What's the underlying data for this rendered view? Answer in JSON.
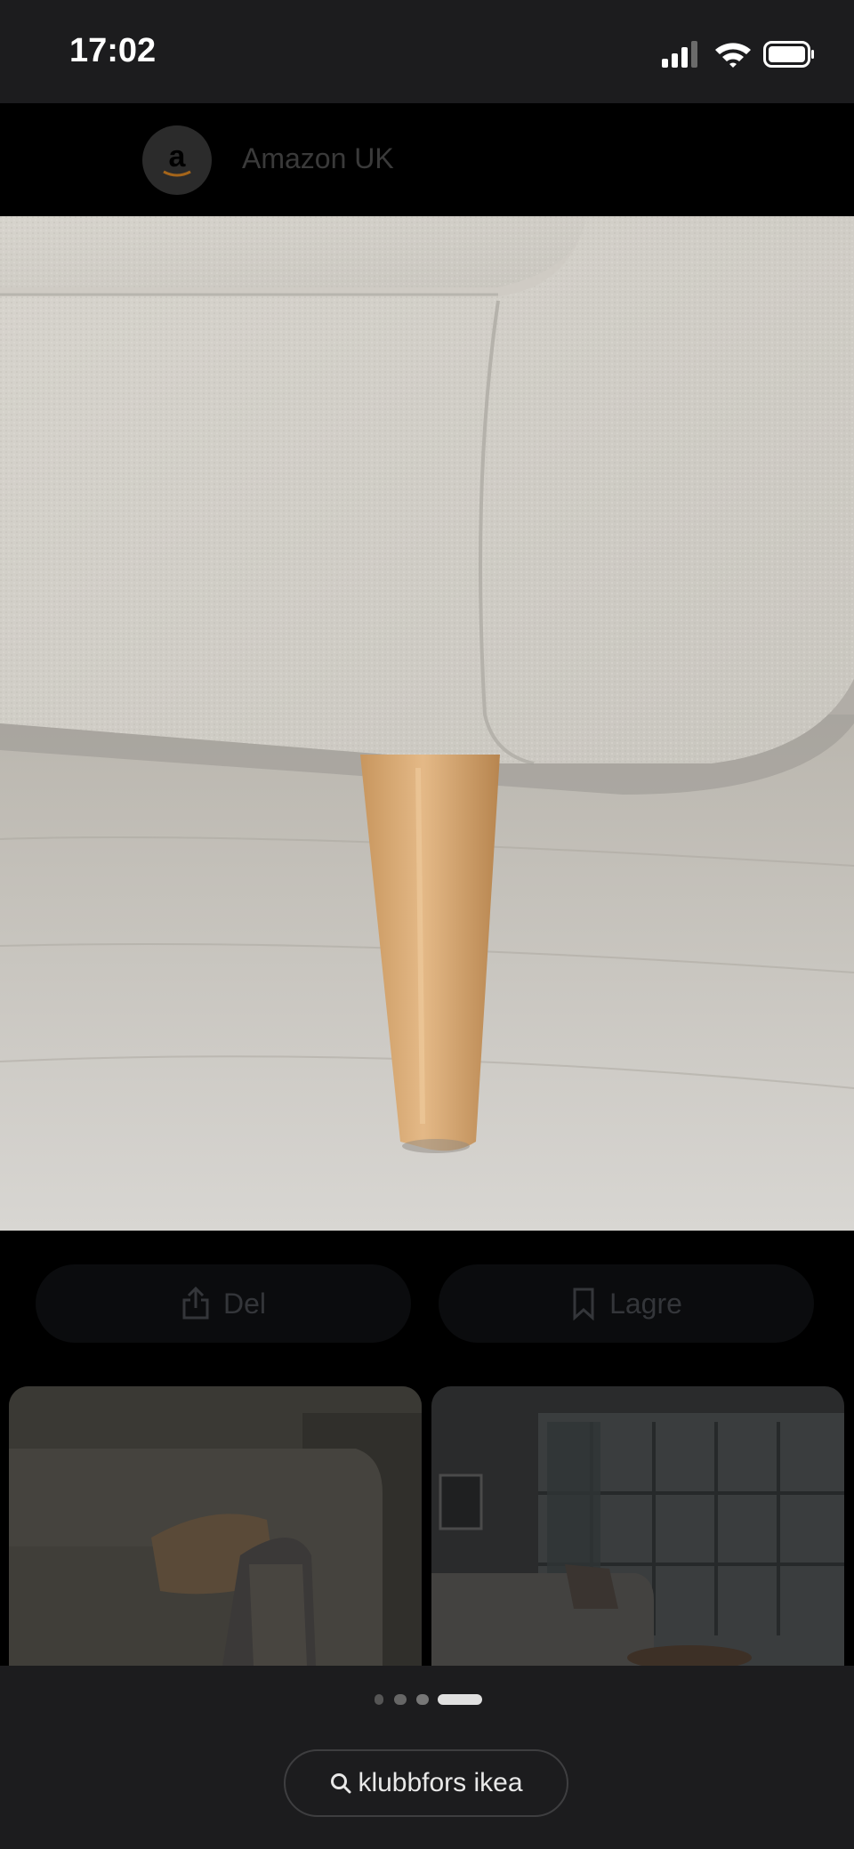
{
  "status_bar": {
    "time": "17:02"
  },
  "source": {
    "name": "Amazon UK",
    "logo_letter": "a"
  },
  "actions": {
    "share_label": "Del",
    "save_label": "Lagre"
  },
  "pager": {
    "count": 4,
    "active_index": 3
  },
  "search": {
    "query": "klubbfors ikea"
  },
  "icons": [
    "signal-icon",
    "wifi-icon",
    "battery-icon",
    "amazon-logo-icon",
    "share-icon",
    "bookmark-icon",
    "search-icon"
  ]
}
